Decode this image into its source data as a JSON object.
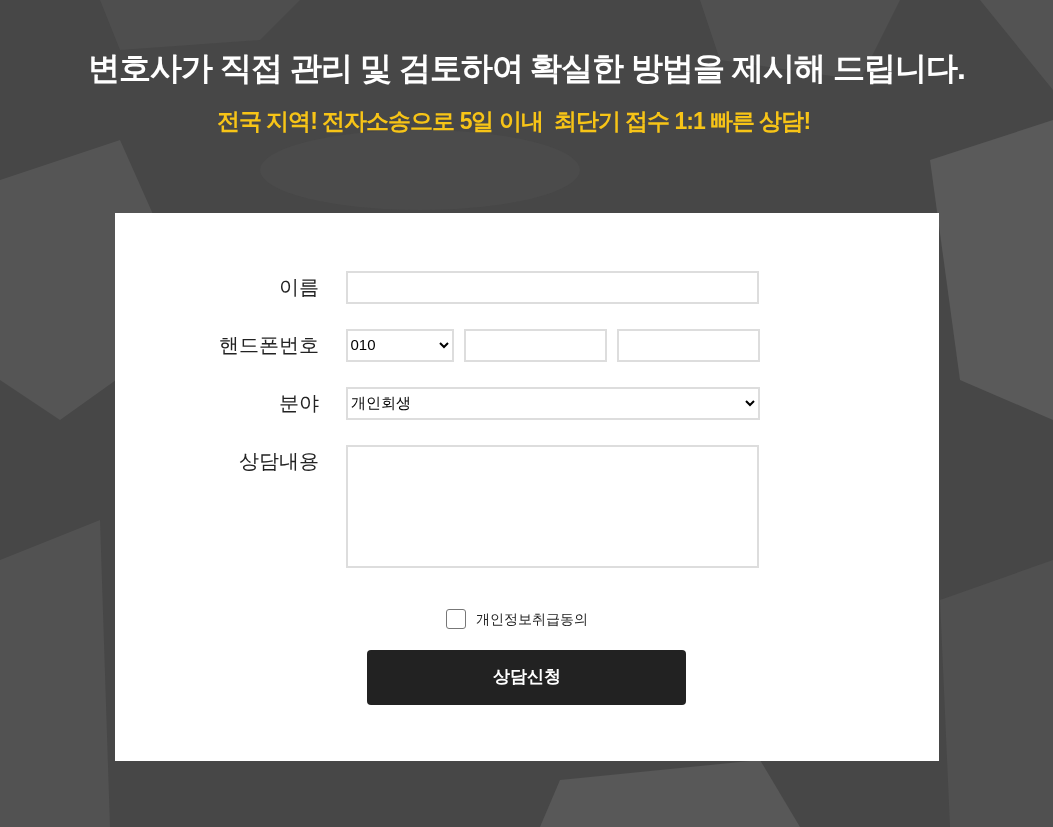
{
  "heading": "변호사가 직접 관리 및 검토하여 확실한 방법을 제시해 드립니다.",
  "subheading": "전국 지역! 전자소송으로 5일 이내  최단기 접수 1:1 빠른 상담!",
  "form": {
    "fields": [
      {
        "kind": "text",
        "label": "이름"
      },
      {
        "kind": "phone",
        "label": "핸드폰번호",
        "prefix": "010"
      },
      {
        "kind": "select",
        "label": "분야",
        "value": "개인회생"
      },
      {
        "kind": "textarea",
        "label": "상담내용"
      }
    ],
    "consent": {
      "label": "개인정보취급동의",
      "checked": false
    },
    "submit": "상담신청"
  }
}
